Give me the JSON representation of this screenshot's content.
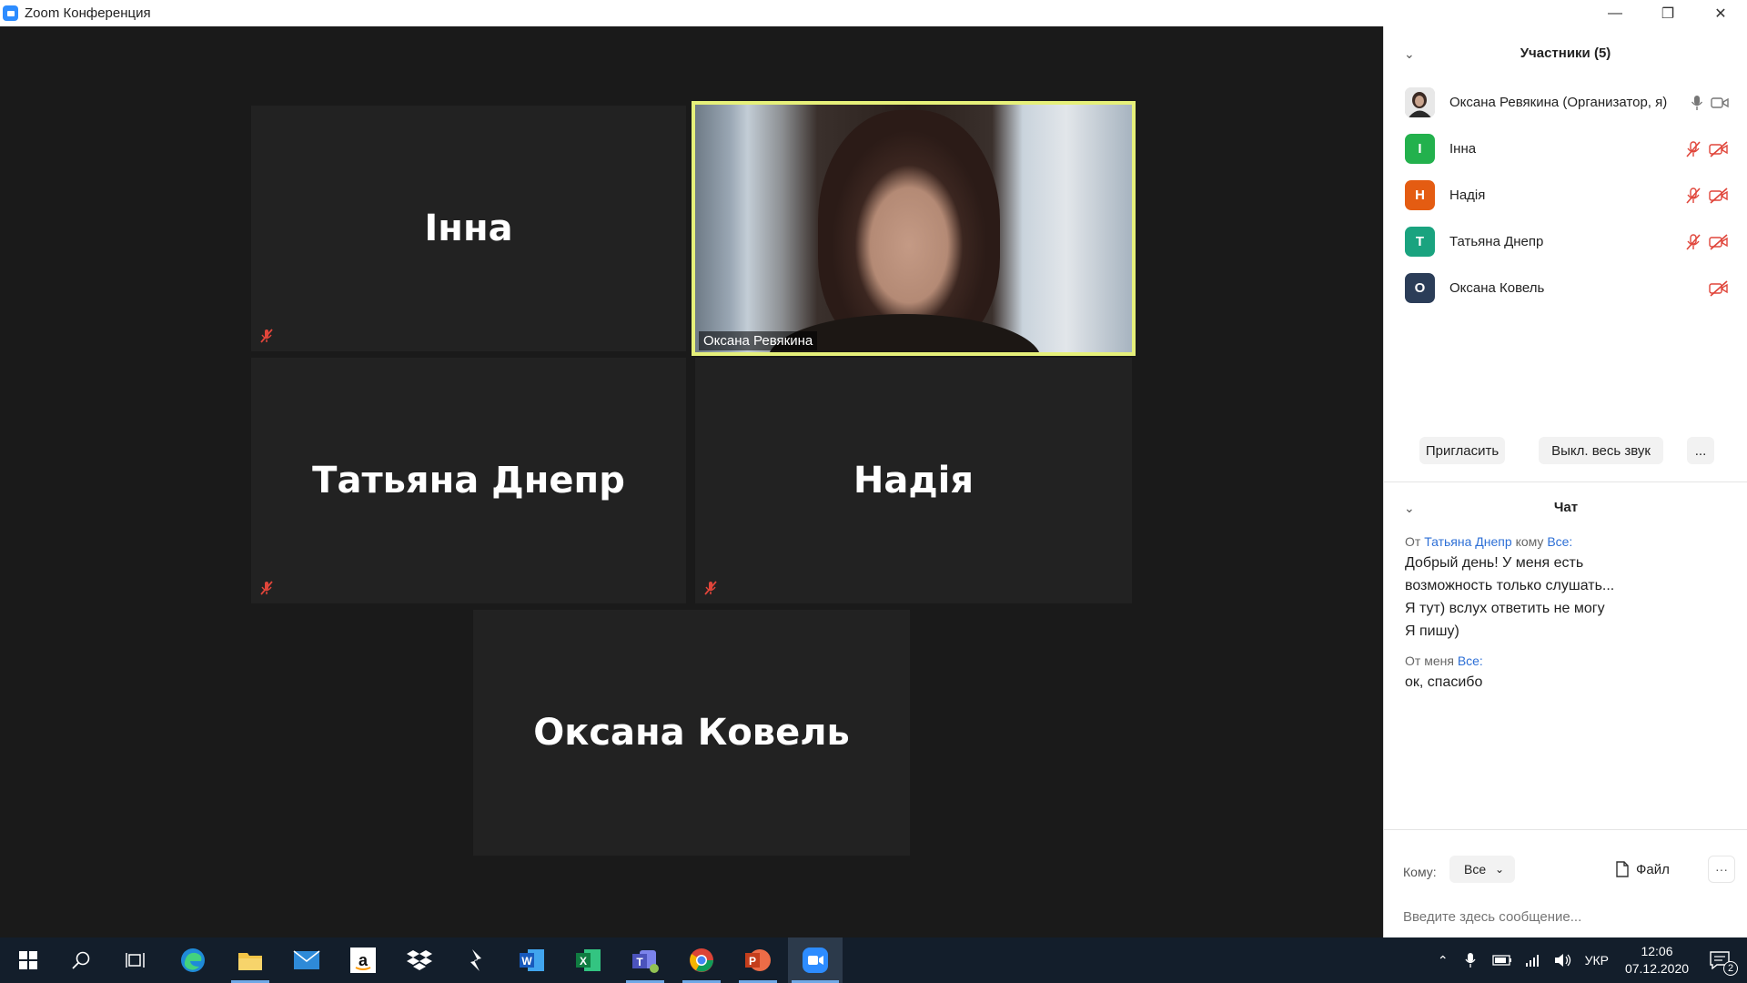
{
  "window": {
    "title": "Zoom Конференция",
    "minimize": "—",
    "restore": "❐",
    "close": "✕"
  },
  "tiles": [
    {
      "name": "Інна",
      "muted": true
    },
    {
      "label": "Оксана Ревякина",
      "active": true
    },
    {
      "name": "Татьяна Днепр",
      "muted": true
    },
    {
      "name": "Надія",
      "muted": true
    },
    {
      "name": "Оксана Ковель",
      "muted": false
    }
  ],
  "participants_panel": {
    "title": "Участники (5)",
    "items": [
      {
        "name": "Оксана Ревякина (Организатор, я)",
        "initial": "",
        "color": "#7a7a7a"
      },
      {
        "name": "Інна",
        "initial": "I",
        "color": "#23b14d"
      },
      {
        "name": "Надія",
        "initial": "Н",
        "color": "#e45c12"
      },
      {
        "name": "Татьяна Днепр",
        "initial": "Т",
        "color": "#1aa37f"
      },
      {
        "name": "Оксана Ковель",
        "initial": "О",
        "color": "#2b3d58"
      }
    ],
    "invite_button": "Пригласить",
    "mute_all_button": "Выкл. весь звук",
    "more_button": "..."
  },
  "chat": {
    "title": "Чат",
    "messages": [
      {
        "from_prefix": "От",
        "from": "Татьяна Днепр",
        "to_prefix": "кому",
        "to": "Все:",
        "lines": [
          "Добрый день! У меня есть",
          "возможность только слушать...",
          "Я тут) вслух ответить не могу",
          "Я пишу)"
        ]
      },
      {
        "from_prefix": "От меня",
        "to": "Все:",
        "lines": [
          "ок, спасибо"
        ]
      }
    ],
    "to_label": "Кому:",
    "to_value": "Все",
    "file_button": "Файл",
    "more": "···",
    "placeholder": "Введите здесь сообщение..."
  },
  "taskbar": {
    "lang": "УКР",
    "time": "12:06",
    "date": "07.12.2020",
    "notifications": "2"
  },
  "colors": {
    "accent": "#2d8cff",
    "active_border": "#e6f07a",
    "mute_red": "#e0453a",
    "link": "#2d6fd6"
  }
}
